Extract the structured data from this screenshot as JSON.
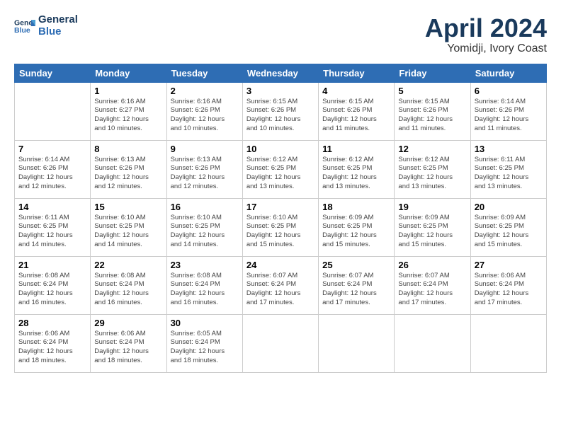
{
  "header": {
    "logo_line1": "General",
    "logo_line2": "Blue",
    "month": "April 2024",
    "location": "Yomidji, Ivory Coast"
  },
  "days_of_week": [
    "Sunday",
    "Monday",
    "Tuesday",
    "Wednesday",
    "Thursday",
    "Friday",
    "Saturday"
  ],
  "weeks": [
    [
      {
        "day": "",
        "info": ""
      },
      {
        "day": "1",
        "info": "Sunrise: 6:16 AM\nSunset: 6:27 PM\nDaylight: 12 hours\nand 10 minutes."
      },
      {
        "day": "2",
        "info": "Sunrise: 6:16 AM\nSunset: 6:26 PM\nDaylight: 12 hours\nand 10 minutes."
      },
      {
        "day": "3",
        "info": "Sunrise: 6:15 AM\nSunset: 6:26 PM\nDaylight: 12 hours\nand 10 minutes."
      },
      {
        "day": "4",
        "info": "Sunrise: 6:15 AM\nSunset: 6:26 PM\nDaylight: 12 hours\nand 11 minutes."
      },
      {
        "day": "5",
        "info": "Sunrise: 6:15 AM\nSunset: 6:26 PM\nDaylight: 12 hours\nand 11 minutes."
      },
      {
        "day": "6",
        "info": "Sunrise: 6:14 AM\nSunset: 6:26 PM\nDaylight: 12 hours\nand 11 minutes."
      }
    ],
    [
      {
        "day": "7",
        "info": "Sunrise: 6:14 AM\nSunset: 6:26 PM\nDaylight: 12 hours\nand 12 minutes."
      },
      {
        "day": "8",
        "info": "Sunrise: 6:13 AM\nSunset: 6:26 PM\nDaylight: 12 hours\nand 12 minutes."
      },
      {
        "day": "9",
        "info": "Sunrise: 6:13 AM\nSunset: 6:26 PM\nDaylight: 12 hours\nand 12 minutes."
      },
      {
        "day": "10",
        "info": "Sunrise: 6:12 AM\nSunset: 6:25 PM\nDaylight: 12 hours\nand 13 minutes."
      },
      {
        "day": "11",
        "info": "Sunrise: 6:12 AM\nSunset: 6:25 PM\nDaylight: 12 hours\nand 13 minutes."
      },
      {
        "day": "12",
        "info": "Sunrise: 6:12 AM\nSunset: 6:25 PM\nDaylight: 12 hours\nand 13 minutes."
      },
      {
        "day": "13",
        "info": "Sunrise: 6:11 AM\nSunset: 6:25 PM\nDaylight: 12 hours\nand 13 minutes."
      }
    ],
    [
      {
        "day": "14",
        "info": "Sunrise: 6:11 AM\nSunset: 6:25 PM\nDaylight: 12 hours\nand 14 minutes."
      },
      {
        "day": "15",
        "info": "Sunrise: 6:10 AM\nSunset: 6:25 PM\nDaylight: 12 hours\nand 14 minutes."
      },
      {
        "day": "16",
        "info": "Sunrise: 6:10 AM\nSunset: 6:25 PM\nDaylight: 12 hours\nand 14 minutes."
      },
      {
        "day": "17",
        "info": "Sunrise: 6:10 AM\nSunset: 6:25 PM\nDaylight: 12 hours\nand 15 minutes."
      },
      {
        "day": "18",
        "info": "Sunrise: 6:09 AM\nSunset: 6:25 PM\nDaylight: 12 hours\nand 15 minutes."
      },
      {
        "day": "19",
        "info": "Sunrise: 6:09 AM\nSunset: 6:25 PM\nDaylight: 12 hours\nand 15 minutes."
      },
      {
        "day": "20",
        "info": "Sunrise: 6:09 AM\nSunset: 6:25 PM\nDaylight: 12 hours\nand 15 minutes."
      }
    ],
    [
      {
        "day": "21",
        "info": "Sunrise: 6:08 AM\nSunset: 6:24 PM\nDaylight: 12 hours\nand 16 minutes."
      },
      {
        "day": "22",
        "info": "Sunrise: 6:08 AM\nSunset: 6:24 PM\nDaylight: 12 hours\nand 16 minutes."
      },
      {
        "day": "23",
        "info": "Sunrise: 6:08 AM\nSunset: 6:24 PM\nDaylight: 12 hours\nand 16 minutes."
      },
      {
        "day": "24",
        "info": "Sunrise: 6:07 AM\nSunset: 6:24 PM\nDaylight: 12 hours\nand 17 minutes."
      },
      {
        "day": "25",
        "info": "Sunrise: 6:07 AM\nSunset: 6:24 PM\nDaylight: 12 hours\nand 17 minutes."
      },
      {
        "day": "26",
        "info": "Sunrise: 6:07 AM\nSunset: 6:24 PM\nDaylight: 12 hours\nand 17 minutes."
      },
      {
        "day": "27",
        "info": "Sunrise: 6:06 AM\nSunset: 6:24 PM\nDaylight: 12 hours\nand 17 minutes."
      }
    ],
    [
      {
        "day": "28",
        "info": "Sunrise: 6:06 AM\nSunset: 6:24 PM\nDaylight: 12 hours\nand 18 minutes."
      },
      {
        "day": "29",
        "info": "Sunrise: 6:06 AM\nSunset: 6:24 PM\nDaylight: 12 hours\nand 18 minutes."
      },
      {
        "day": "30",
        "info": "Sunrise: 6:05 AM\nSunset: 6:24 PM\nDaylight: 12 hours\nand 18 minutes."
      },
      {
        "day": "",
        "info": ""
      },
      {
        "day": "",
        "info": ""
      },
      {
        "day": "",
        "info": ""
      },
      {
        "day": "",
        "info": ""
      }
    ]
  ]
}
